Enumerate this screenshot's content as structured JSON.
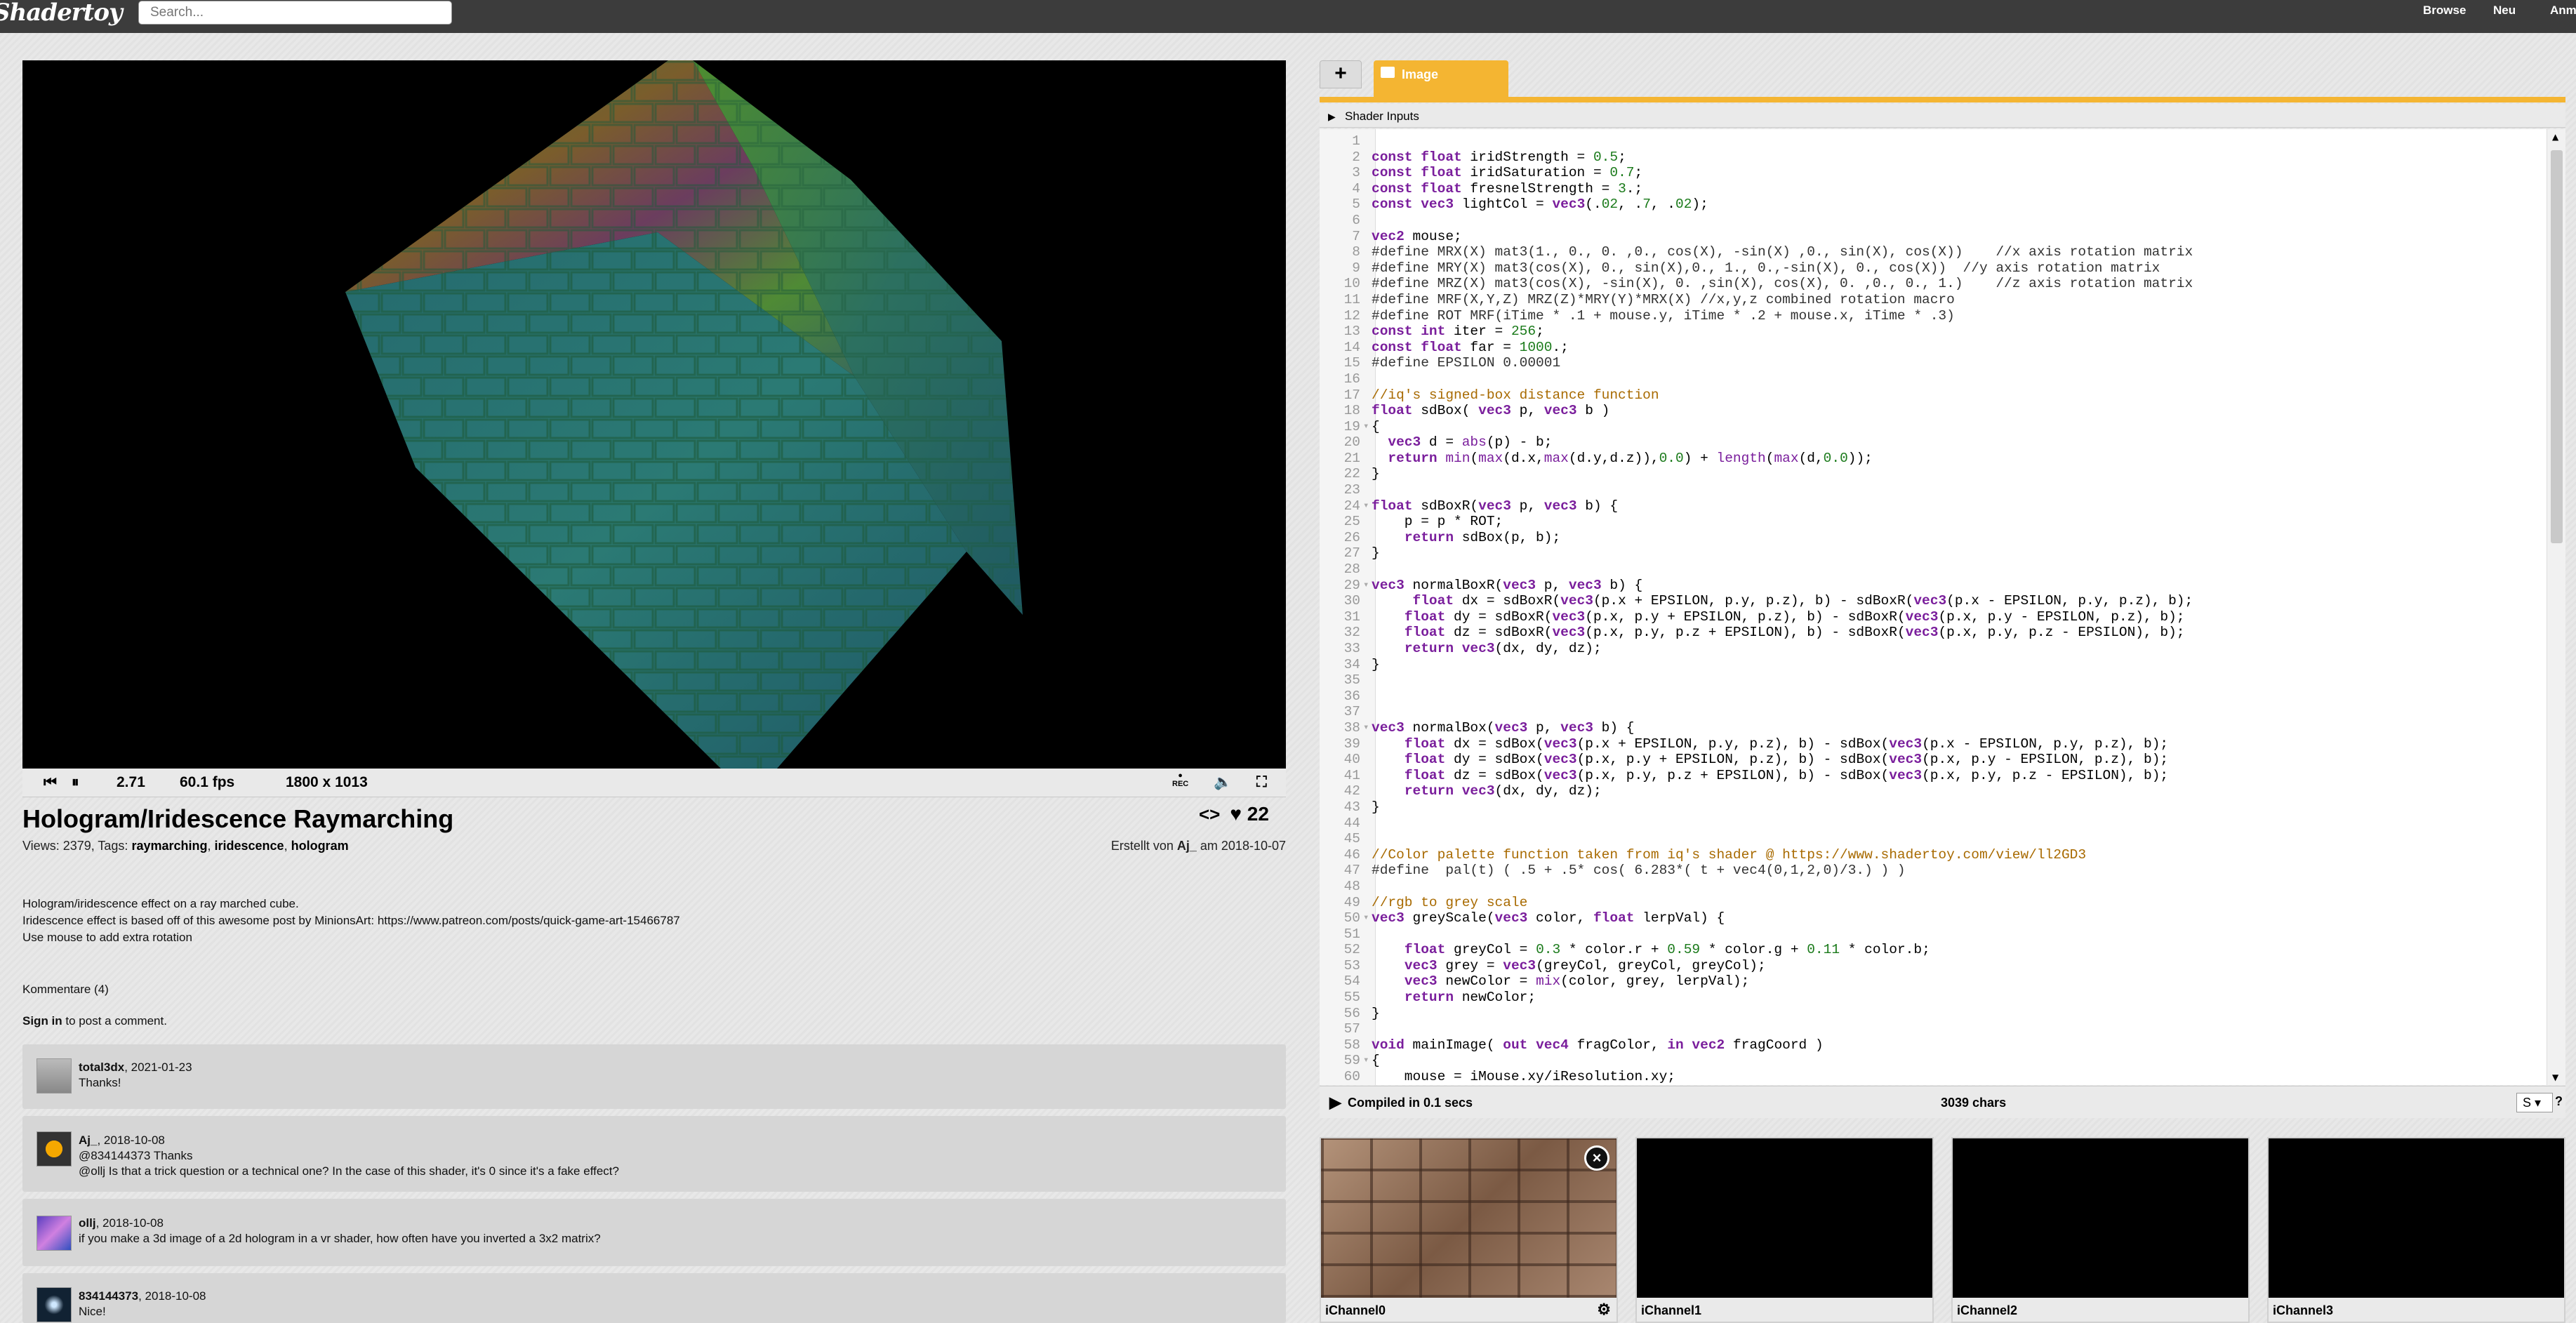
{
  "topbar": {
    "logo": "Shadertoy",
    "search_placeholder": "Search...",
    "nav": [
      "Browse",
      "Neu",
      "Anm"
    ]
  },
  "player": {
    "time": "2.71",
    "fps": "60.1 fps",
    "resolution": "1800 x 1013",
    "rec_label": "REC"
  },
  "shader": {
    "title": "Hologram/Iridescence Raymarching",
    "views_label": "Views: 2379, Tags: ",
    "tags": [
      "raymarching",
      "iridescence",
      "hologram"
    ],
    "likes": "22",
    "created_prefix": "Erstellt von ",
    "author": "Aj_",
    "created_suffix": " am 2018-10-07",
    "description": [
      "Hologram/iridescence effect on a ray marched cube.",
      "Iridescence effect is based off of this awesome post by MinionsArt: https://www.patreon.com/posts/quick-game-art-15466787",
      "Use mouse to add extra rotation"
    ]
  },
  "comments_section": {
    "header": "Kommentare (4)",
    "signin_link": "Sign in",
    "signin_rest": " to post a comment."
  },
  "comments": [
    {
      "user": "total3dx",
      "date": ", 2021-01-23",
      "lines": [
        "Thanks!"
      ]
    },
    {
      "user": "Aj_",
      "date": ", 2018-10-08",
      "lines": [
        "@834144373 Thanks",
        "@ollj Is that a trick question or a technical one? In the case of this shader, it's 0 since it's a fake effect?"
      ]
    },
    {
      "user": "ollj",
      "date": ", 2018-10-08",
      "lines": [
        "if you make a 3d image of a 2d hologram in a vr shader, how often have you inverted a 3x2 matrix?"
      ]
    },
    {
      "user": "834144373",
      "date": ", 2018-10-08",
      "lines": [
        "Nice!"
      ]
    }
  ],
  "editor": {
    "tab_plus": "+",
    "tab_image": "Image",
    "shader_inputs": "Shader Inputs",
    "status_compiled": "Compiled in 0.1 secs",
    "status_chars": "3039 chars",
    "font_size": "S",
    "help": "?",
    "code": [
      {
        "n": "1",
        "t": ""
      },
      {
        "n": "2",
        "t": "const float iridStrength = 0.5;"
      },
      {
        "n": "3",
        "t": "const float iridSaturation = 0.7;"
      },
      {
        "n": "4",
        "t": "const float fresnelStrength = 3.;"
      },
      {
        "n": "5",
        "t": "const vec3 lightCol = vec3(.02, .7, .02);"
      },
      {
        "n": "6",
        "t": ""
      },
      {
        "n": "7",
        "t": "vec2 mouse;"
      },
      {
        "n": "8",
        "t": "#define MRX(X) mat3(1., 0., 0. ,0., cos(X), -sin(X) ,0., sin(X), cos(X))    //x axis rotation matrix"
      },
      {
        "n": "9",
        "t": "#define MRY(X) mat3(cos(X), 0., sin(X),0., 1., 0.,-sin(X), 0., cos(X))  //y axis rotation matrix"
      },
      {
        "n": "10",
        "t": "#define MRZ(X) mat3(cos(X), -sin(X), 0. ,sin(X), cos(X), 0. ,0., 0., 1.)    //z axis rotation matrix"
      },
      {
        "n": "11",
        "t": "#define MRF(X,Y,Z) MRZ(Z)*MRY(Y)*MRX(X) //x,y,z combined rotation macro"
      },
      {
        "n": "12",
        "t": "#define ROT MRF(iTime * .1 + mouse.y, iTime * .2 + mouse.x, iTime * .3)"
      },
      {
        "n": "13",
        "t": "const int iter = 256;"
      },
      {
        "n": "14",
        "t": "const float far = 1000.;"
      },
      {
        "n": "15",
        "t": "#define EPSILON 0.00001"
      },
      {
        "n": "16",
        "t": ""
      },
      {
        "n": "17",
        "t": "//iq's signed-box distance function"
      },
      {
        "n": "18",
        "t": "float sdBox( vec3 p, vec3 b )"
      },
      {
        "n": "19",
        "t": "{"
      },
      {
        "n": "20",
        "t": "  vec3 d = abs(p) - b;"
      },
      {
        "n": "21",
        "t": "  return min(max(d.x,max(d.y,d.z)),0.0) + length(max(d,0.0));"
      },
      {
        "n": "22",
        "t": "}"
      },
      {
        "n": "23",
        "t": ""
      },
      {
        "n": "24",
        "t": "float sdBoxR(vec3 p, vec3 b) {"
      },
      {
        "n": "25",
        "t": "    p = p * ROT;"
      },
      {
        "n": "26",
        "t": "    return sdBox(p, b);"
      },
      {
        "n": "27",
        "t": "}"
      },
      {
        "n": "28",
        "t": ""
      },
      {
        "n": "29",
        "t": "vec3 normalBoxR(vec3 p, vec3 b) {"
      },
      {
        "n": "30",
        "t": "     float dx = sdBoxR(vec3(p.x + EPSILON, p.y, p.z), b) - sdBoxR(vec3(p.x - EPSILON, p.y, p.z), b);"
      },
      {
        "n": "31",
        "t": "    float dy = sdBoxR(vec3(p.x, p.y + EPSILON, p.z), b) - sdBoxR(vec3(p.x, p.y - EPSILON, p.z), b);"
      },
      {
        "n": "32",
        "t": "    float dz = sdBoxR(vec3(p.x, p.y, p.z + EPSILON), b) - sdBoxR(vec3(p.x, p.y, p.z - EPSILON), b);"
      },
      {
        "n": "33",
        "t": "    return vec3(dx, dy, dz);"
      },
      {
        "n": "34",
        "t": "}"
      },
      {
        "n": "35",
        "t": ""
      },
      {
        "n": "36",
        "t": ""
      },
      {
        "n": "37",
        "t": ""
      },
      {
        "n": "38",
        "t": "vec3 normalBox(vec3 p, vec3 b) {"
      },
      {
        "n": "39",
        "t": "    float dx = sdBox(vec3(p.x + EPSILON, p.y, p.z), b) - sdBox(vec3(p.x - EPSILON, p.y, p.z), b);"
      },
      {
        "n": "40",
        "t": "    float dy = sdBox(vec3(p.x, p.y + EPSILON, p.z), b) - sdBox(vec3(p.x, p.y - EPSILON, p.z), b);"
      },
      {
        "n": "41",
        "t": "    float dz = sdBox(vec3(p.x, p.y, p.z + EPSILON), b) - sdBox(vec3(p.x, p.y, p.z - EPSILON), b);"
      },
      {
        "n": "42",
        "t": "    return vec3(dx, dy, dz);"
      },
      {
        "n": "43",
        "t": "}"
      },
      {
        "n": "44",
        "t": ""
      },
      {
        "n": "45",
        "t": ""
      },
      {
        "n": "46",
        "t": "//Color palette function taken from iq's shader @ https://www.shadertoy.com/view/ll2GD3"
      },
      {
        "n": "47",
        "t": "#define  pal(t) ( .5 + .5* cos( 6.283*( t + vec4(0,1,2,0)/3.) ) )"
      },
      {
        "n": "48",
        "t": ""
      },
      {
        "n": "49",
        "t": "//rgb to grey scale"
      },
      {
        "n": "50",
        "t": "vec3 greyScale(vec3 color, float lerpVal) {"
      },
      {
        "n": "51",
        "t": ""
      },
      {
        "n": "52",
        "t": "    float greyCol = 0.3 * color.r + 0.59 * color.g + 0.11 * color.b;"
      },
      {
        "n": "53",
        "t": "    vec3 grey = vec3(greyCol, greyCol, greyCol);"
      },
      {
        "n": "54",
        "t": "    vec3 newColor = mix(color, grey, lerpVal);"
      },
      {
        "n": "55",
        "t": "    return newColor;"
      },
      {
        "n": "56",
        "t": "}"
      },
      {
        "n": "57",
        "t": ""
      },
      {
        "n": "58",
        "t": "void mainImage( out vec4 fragColor, in vec2 fragCoord )"
      },
      {
        "n": "59",
        "t": "{"
      },
      {
        "n": "60",
        "t": "    mouse = iMouse.xy/iResolution.xy;"
      }
    ],
    "fold_lines": [
      "19",
      "24",
      "29",
      "38",
      "50",
      "59"
    ]
  },
  "channels": [
    "iChannel0",
    "iChannel1",
    "iChannel2",
    "iChannel3"
  ],
  "colors": {
    "topbar": "#3c3c3c",
    "accent_tab": "#f4b532",
    "keyword": "#7a1e9c",
    "type": "#7a1e9c",
    "number": "#1a7a1a",
    "comment": "#a86a00"
  }
}
